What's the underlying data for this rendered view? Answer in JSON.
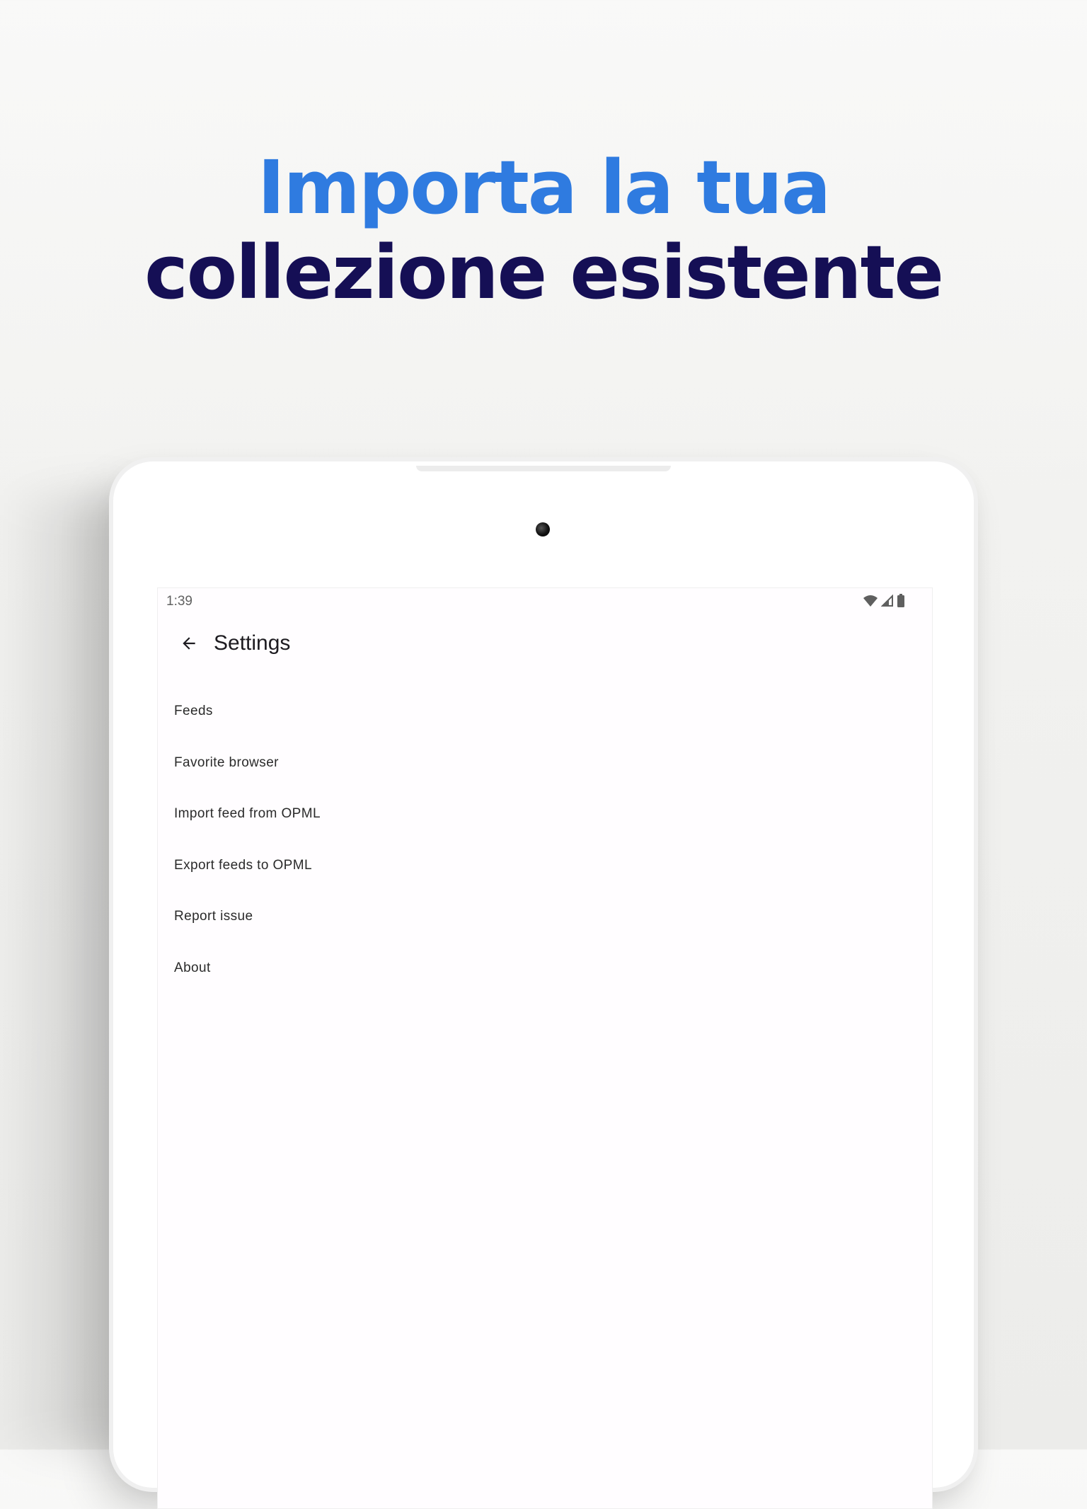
{
  "headline": {
    "line1": "Importa la tua",
    "line2": "collezione esistente"
  },
  "colors": {
    "headline_accent": "#2f7be0",
    "headline_dark": "#150f55",
    "background": "#f2f2f0"
  },
  "device": {
    "status_bar": {
      "time": "1:39",
      "icons": [
        "wifi-icon",
        "signal-icon",
        "battery-icon"
      ]
    },
    "app_bar": {
      "back_icon": "arrow-left-icon",
      "title": "Settings"
    },
    "menu": {
      "items": [
        {
          "label": "Feeds"
        },
        {
          "label": "Favorite browser"
        },
        {
          "label": "Import feed from OPML"
        },
        {
          "label": "Export feeds to OPML"
        },
        {
          "label": "Report issue"
        },
        {
          "label": "About"
        }
      ]
    }
  }
}
